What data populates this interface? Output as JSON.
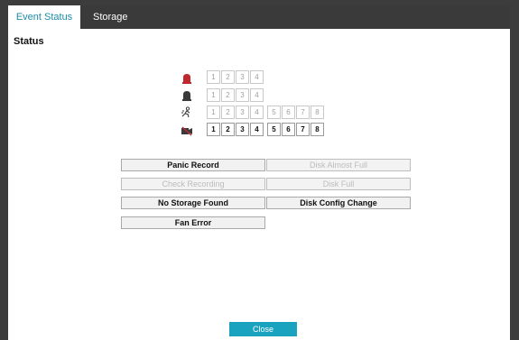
{
  "tabs": [
    {
      "label": "Event Status",
      "active": true
    },
    {
      "label": "Storage",
      "active": false
    }
  ],
  "section_title": "Status",
  "rows": [
    {
      "icon": "alarm-icon",
      "channels": [
        {
          "n": "1",
          "active": false
        },
        {
          "n": "2",
          "active": false
        },
        {
          "n": "3",
          "active": false
        },
        {
          "n": "4",
          "active": false
        }
      ]
    },
    {
      "icon": "alarm-out-icon",
      "channels": [
        {
          "n": "1",
          "active": false
        },
        {
          "n": "2",
          "active": false
        },
        {
          "n": "3",
          "active": false
        },
        {
          "n": "4",
          "active": false
        }
      ]
    },
    {
      "icon": "motion-icon",
      "channels": [
        {
          "n": "1",
          "active": false
        },
        {
          "n": "2",
          "active": false
        },
        {
          "n": "3",
          "active": false
        },
        {
          "n": "4",
          "active": false
        },
        {
          "n": "5",
          "active": false
        },
        {
          "n": "6",
          "active": false
        },
        {
          "n": "7",
          "active": false
        },
        {
          "n": "8",
          "active": false
        }
      ]
    },
    {
      "icon": "video-loss-icon",
      "channels": [
        {
          "n": "1",
          "active": true
        },
        {
          "n": "2",
          "active": true
        },
        {
          "n": "3",
          "active": true
        },
        {
          "n": "4",
          "active": true
        },
        {
          "n": "5",
          "active": true
        },
        {
          "n": "6",
          "active": true
        },
        {
          "n": "7",
          "active": true
        },
        {
          "n": "8",
          "active": true
        }
      ]
    }
  ],
  "status_buttons": [
    {
      "label": "Panic Record",
      "active": true
    },
    {
      "label": "Disk Almost Full",
      "active": false
    },
    {
      "label": "Check Recording",
      "active": false
    },
    {
      "label": "Disk Full",
      "active": false
    },
    {
      "label": "No Storage Found",
      "active": true
    },
    {
      "label": "Disk Config Change",
      "active": true
    },
    {
      "label": "Fan Error",
      "active": true
    }
  ],
  "close_label": "Close",
  "colors": {
    "accent": "#1aa3bf",
    "tab_active_text": "#1d8ca8",
    "alarm_red": "#c0282d",
    "dark_icon": "#3a3a3a"
  }
}
